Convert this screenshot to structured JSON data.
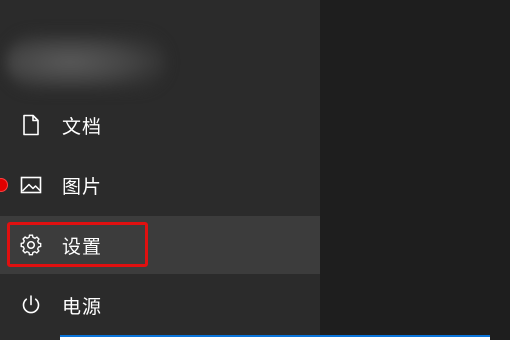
{
  "start_menu": {
    "items": [
      {
        "label": "文档",
        "icon": "document-icon"
      },
      {
        "label": "图片",
        "icon": "picture-icon"
      },
      {
        "label": "设置",
        "icon": "gear-icon",
        "selected": true
      },
      {
        "label": "电源",
        "icon": "power-icon"
      }
    ]
  },
  "colors": {
    "panel_bg": "#2b2b2b",
    "selected_bg": "#3c3c3c",
    "highlight": "#e01010",
    "accent_blue": "#0a74da"
  }
}
